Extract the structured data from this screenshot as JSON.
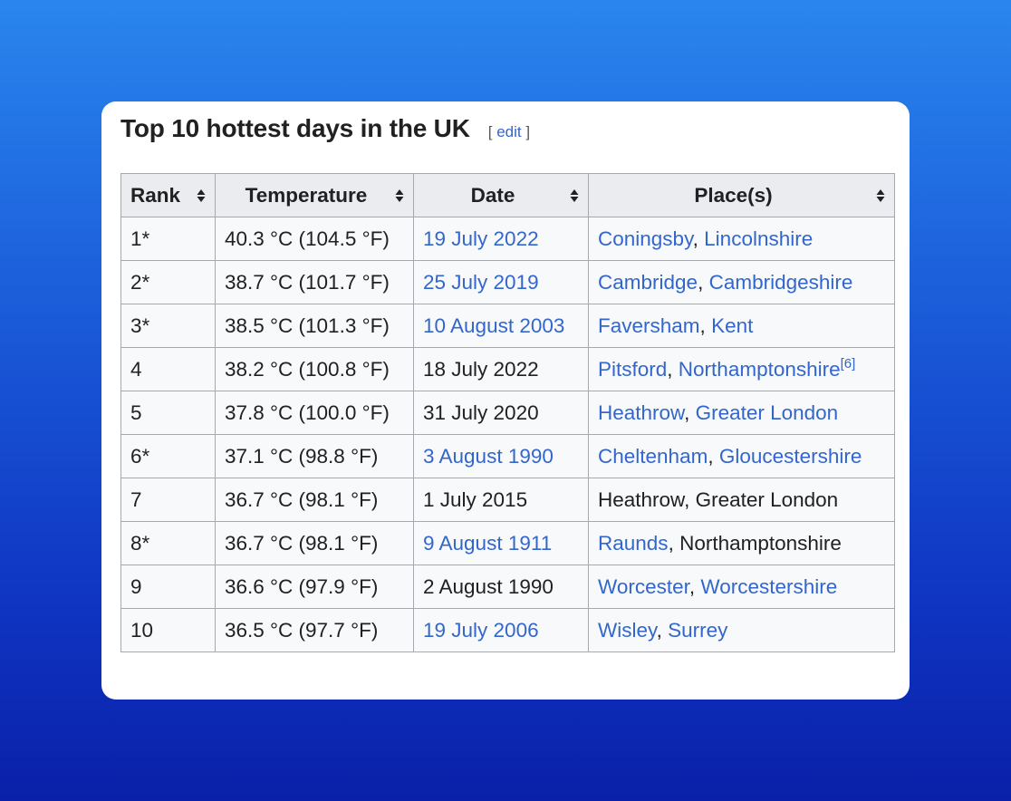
{
  "heading": {
    "title": "Top 10 hottest days in the UK",
    "edit_open": "[ ",
    "edit_label": "edit",
    "edit_close": " ]"
  },
  "table": {
    "headers": [
      "Rank",
      "Temperature",
      "Date",
      "Place(s)"
    ],
    "rows": [
      {
        "rank": "1*",
        "temp": "40.3 °C (104.5 °F)",
        "date": "19 July 2022",
        "date_link": true,
        "place_a": "Coningsby",
        "place_a_link": true,
        "sep": ", ",
        "place_b": "Lincolnshire",
        "place_b_link": true,
        "ref": ""
      },
      {
        "rank": "2*",
        "temp": "38.7 °C (101.7 °F)",
        "date": "25 July 2019",
        "date_link": true,
        "place_a": "Cambridge",
        "place_a_link": true,
        "sep": ", ",
        "place_b": "Cambridgeshire",
        "place_b_link": true,
        "ref": ""
      },
      {
        "rank": "3*",
        "temp": "38.5 °C (101.3 °F)",
        "date": "10 August 2003",
        "date_link": true,
        "place_a": "Faversham",
        "place_a_link": true,
        "sep": ", ",
        "place_b": "Kent",
        "place_b_link": true,
        "ref": ""
      },
      {
        "rank": "4",
        "temp": "38.2 °C (100.8 °F)",
        "date": "18 July 2022",
        "date_link": false,
        "place_a": "Pitsford",
        "place_a_link": true,
        "sep": ", ",
        "place_b": "Northamptonshire",
        "place_b_link": true,
        "ref": "[6]"
      },
      {
        "rank": "5",
        "temp": "37.8 °C (100.0 °F)",
        "date": "31 July 2020",
        "date_link": false,
        "place_a": "Heathrow",
        "place_a_link": true,
        "sep": ", ",
        "place_b": "Greater London",
        "place_b_link": true,
        "ref": ""
      },
      {
        "rank": "6*",
        "temp": "37.1 °C (98.8 °F)",
        "date": "3 August 1990",
        "date_link": true,
        "place_a": "Cheltenham",
        "place_a_link": true,
        "sep": ", ",
        "place_b": "Gloucestershire",
        "place_b_link": true,
        "ref": ""
      },
      {
        "rank": "7",
        "temp": "36.7 °C (98.1 °F)",
        "date": "1 July 2015",
        "date_link": false,
        "place_a": "Heathrow",
        "place_a_link": false,
        "sep": ", ",
        "place_b": "Greater London",
        "place_b_link": false,
        "ref": ""
      },
      {
        "rank": "8*",
        "temp": "36.7 °C (98.1 °F)",
        "date": "9 August 1911",
        "date_link": true,
        "place_a": "Raunds",
        "place_a_link": true,
        "sep": ", ",
        "place_b": "Northamptonshire",
        "place_b_link": false,
        "ref": ""
      },
      {
        "rank": "9",
        "temp": "36.6 °C (97.9 °F)",
        "date": "2 August 1990",
        "date_link": false,
        "place_a": "Worcester",
        "place_a_link": true,
        "sep": ", ",
        "place_b": "Worcestershire",
        "place_b_link": true,
        "ref": ""
      },
      {
        "rank": "10",
        "temp": "36.5 °C (97.7 °F)",
        "date": "19 July 2006",
        "date_link": true,
        "place_a": "Wisley",
        "place_a_link": true,
        "sep": ", ",
        "place_b": "Surrey",
        "place_b_link": true,
        "ref": ""
      }
    ]
  },
  "colors": {
    "link": "#3366cc",
    "text": "#202122",
    "header_bg": "#eaecf0",
    "cell_bg": "#f8f9fa",
    "border": "#a2a9b1"
  },
  "icons": {
    "sort": "sort-icon"
  }
}
